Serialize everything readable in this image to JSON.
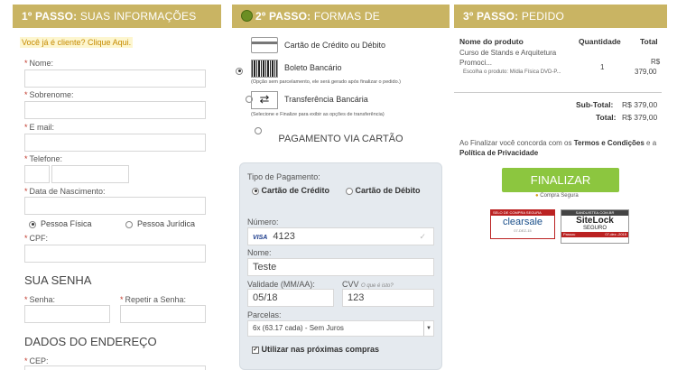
{
  "step1": {
    "title_bold": "1º PASSO:",
    "title_rest": " SUAS INFORMAÇÕES",
    "already_client": "Você já é cliente? Clique Aqui.",
    "nome": "Nome:",
    "sobrenome": "Sobrenome:",
    "email": "E mail:",
    "telefone": "Telefone:",
    "nascimento": "Data de Nascimento:",
    "pf": "Pessoa Física",
    "pj": "Pessoa Jurídica",
    "cpf": "CPF:",
    "senha_title": "SUA SENHA",
    "senha": "Senha:",
    "repetir": "Repetir a Senha:",
    "endereco_title": "DADOS DO ENDEREÇO",
    "cep": "CEP:",
    "req": "*"
  },
  "step2": {
    "title_bold": "2º PASSO:",
    "title_rest": " FORMAS DE PAGAMENTO",
    "opt_card": "Cartão de Crédito ou Débito",
    "opt_boleto": "Boleto Bancário",
    "boleto_note": "(Opção sem parcelamento, ele será gerado após finalizar o pedido.)",
    "opt_transfer": "Transferência Bancária",
    "transfer_note": "(Selecione e Finalize para exibir as opções de transferência)",
    "pay_title": "PAGAMENTO VIA CARTÃO",
    "tipo_label": "Tipo de Pagamento:",
    "credito": "Cartão de Crédito",
    "debito": "Cartão de Débito",
    "numero_label": "Número:",
    "visa": "VISA",
    "numero_value": "4123",
    "nome_label": "Nome:",
    "nome_value": "Teste",
    "validade_label": "Validade (MM/AA):",
    "validade_value": "05/18",
    "cvv_label": "CVV",
    "cvv_hint": "O que é isto?",
    "cvv_value": "123",
    "parcelas_label": "Parcelas:",
    "parcelas_value": "6x (63.17 cada) - Sem Juros",
    "save_label": "Utilizar nas próximas compras"
  },
  "step3": {
    "title_bold": "3º PASSO:",
    "title_rest": " PEDIDO",
    "col_product": "Nome do produto",
    "col_qty": "Quantidade",
    "col_total": "Total",
    "product_name": "Curso de Stands e Arquitetura Promoci...",
    "product_sub": "Escolha o produto: Mídia Física DVD-P...",
    "qty": "1",
    "price_currency": "R$",
    "price_value": "379,00",
    "subtotal_label": "Sub-Total:",
    "subtotal_value": "R$ 379,00",
    "total_label": "Total:",
    "total_value": "R$ 379,00",
    "terms_pre": "Ao Finalizar você concorda com os ",
    "terms_link": "Termos e Condições",
    "terms_mid": " e a ",
    "privacy_link": "Política de Privacidade",
    "finalize": "FINALIZAR",
    "secure": "Compra Segura",
    "clearsale_top": "SELO DE COMPRA SEGURA",
    "clearsale": "clearsale",
    "clearsale_date": "07-DEZ-15",
    "sitelock_top": "SANDUISTEA.COM.BR",
    "sitelock": "SiteLock",
    "sitelock_sub": "SEGURO",
    "sitelock_passou": "Passou",
    "sitelock_date": "07-dez.-2015"
  },
  "colors": {
    "header": "#c9b463",
    "finalize": "#8cc63f",
    "required": "#c0392b"
  }
}
